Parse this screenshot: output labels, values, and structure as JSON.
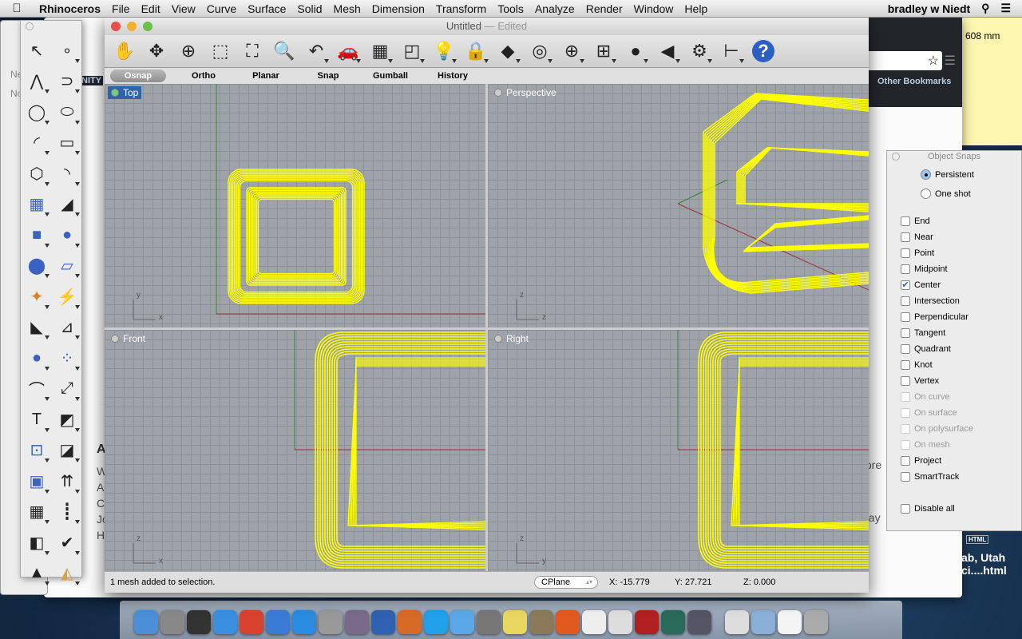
{
  "menubar": {
    "apple_icon": "apple-icon",
    "app": "Rhinoceros",
    "items": [
      "File",
      "Edit",
      "View",
      "Curve",
      "Surface",
      "Solid",
      "Mesh",
      "Dimension",
      "Transform",
      "Tools",
      "Analyze",
      "Render",
      "Window",
      "Help"
    ],
    "user": "bradley w Niedt"
  },
  "background": {
    "notes_text": "608 mm",
    "bookmarks": "Other Bookmarks",
    "nity": "NITY",
    "utah": "ab, Utah",
    "html": "ci....html",
    "html_badge": "HTML",
    "tore": "tore",
    "day": "day",
    "letters": [
      "A",
      "W",
      "A",
      "C",
      "Jo",
      "H"
    ],
    "no": "No",
    "ne": "Ne"
  },
  "window": {
    "title": "Untitled",
    "edited": "— Edited"
  },
  "toolbar": [
    {
      "icon": "hand-pan-icon",
      "g": "✋"
    },
    {
      "icon": "rotate-view-icon",
      "g": "✥"
    },
    {
      "icon": "zoom-in-out-icon",
      "g": "⊕"
    },
    {
      "icon": "zoom-window-icon",
      "g": "⬚"
    },
    {
      "icon": "zoom-extents-icon",
      "g": "⛶"
    },
    {
      "icon": "zoom-selected-icon",
      "g": "🔍"
    },
    {
      "icon": "undo-view-icon",
      "g": "↶"
    },
    {
      "icon": "car-view-icon",
      "g": "🚗"
    },
    {
      "icon": "cplane-icon",
      "g": "▦"
    },
    {
      "icon": "select-objects-icon",
      "g": "◰"
    },
    {
      "icon": "lightbulb-icon",
      "g": "💡"
    },
    {
      "icon": "lock-icon",
      "g": "🔒"
    },
    {
      "icon": "layers-icon",
      "g": "◆"
    },
    {
      "icon": "color-wheel-icon",
      "g": "◎"
    },
    {
      "icon": "wireframe-sphere-icon",
      "g": "⊕"
    },
    {
      "icon": "grid-sphere-icon",
      "g": "⊞"
    },
    {
      "icon": "render-sphere-icon",
      "g": "●"
    },
    {
      "icon": "render-cone-icon",
      "g": "◀"
    },
    {
      "icon": "options-gear-icon",
      "g": "⚙"
    },
    {
      "icon": "dimension-icon",
      "g": "⊢"
    },
    {
      "icon": "help-icon",
      "g": "?"
    }
  ],
  "tabs": [
    {
      "label": "Osnap",
      "active": true
    },
    {
      "label": "Ortho"
    },
    {
      "label": "Planar"
    },
    {
      "label": "Snap"
    },
    {
      "label": "Gumball"
    },
    {
      "label": "History"
    }
  ],
  "viewports": [
    {
      "label": "Top",
      "active": true
    },
    {
      "label": "Perspective"
    },
    {
      "label": "Front"
    },
    {
      "label": "Right"
    }
  ],
  "axes": {
    "x": "x",
    "y": "y",
    "z": "z"
  },
  "status": {
    "message": "1 mesh added to selection.",
    "cplane": "CPlane",
    "x": "X: -15.779",
    "y": "Y: 27.721",
    "z": "Z: 0.000"
  },
  "palette": [
    "select-arrow-icon",
    "point-icon",
    "polyline-icon",
    "curve-icon",
    "circle-icon",
    "ellipse-icon",
    "arc-icon",
    "rectangle-icon",
    "polygon-icon",
    "fillet-icon",
    "surface-icon",
    "loft-icon",
    "box-icon",
    "sphere-icon",
    "cylinder-icon",
    "plane-icon",
    "puzzle-join-icon",
    "explode-icon",
    "trim-icon",
    "split-icon",
    "boolean-icon",
    "group-icon",
    "offset-icon",
    "scale-icon",
    "text-icon",
    "transform-icon",
    "array-grid-icon",
    "bend-icon",
    "solid-edit-icon",
    "extrude-arrows-icon",
    "array-icon",
    "mirror-icon",
    "flow-icon",
    "check-icon",
    "shapes-icon",
    "render-material-icon"
  ],
  "palette_glyphs": [
    "↖",
    "∘",
    "⋀",
    "⊃",
    "◯",
    "⬭",
    "◜",
    "▭",
    "⬡",
    "◝",
    "▦",
    "◢",
    "■",
    "●",
    "⬤",
    "▱",
    "✦",
    "⚡",
    "◣",
    "⊿",
    "●",
    "⁘",
    "⌒",
    "⤢",
    "T",
    "◩",
    "⊡",
    "◪",
    "▣",
    "⇈",
    "▦",
    "┋",
    "◧",
    "✔",
    "▲",
    "◭"
  ],
  "snaps": {
    "title": "Object Snaps",
    "modes": [
      {
        "label": "Persistent",
        "on": true
      },
      {
        "label": "One shot",
        "on": false
      }
    ],
    "items": [
      {
        "label": "End"
      },
      {
        "label": "Near"
      },
      {
        "label": "Point"
      },
      {
        "label": "Midpoint"
      },
      {
        "label": "Center",
        "checked": true
      },
      {
        "label": "Intersection"
      },
      {
        "label": "Perpendicular"
      },
      {
        "label": "Tangent"
      },
      {
        "label": "Quadrant"
      },
      {
        "label": "Knot"
      },
      {
        "label": "Vertex"
      },
      {
        "label": "On curve",
        "disabled": true
      },
      {
        "label": "On surface",
        "disabled": true
      },
      {
        "label": "On polysurface",
        "disabled": true
      },
      {
        "label": "On mesh",
        "disabled": true
      },
      {
        "label": "Project"
      },
      {
        "label": "SmartTrack"
      }
    ],
    "disable_all": "Disable all"
  },
  "dock": [
    {
      "icon": "finder-icon",
      "c": "#4a8fd8"
    },
    {
      "icon": "launchpad-icon",
      "c": "#888"
    },
    {
      "icon": "dashboard-icon",
      "c": "#333"
    },
    {
      "icon": "itunes-icon",
      "c": "#3a8fe0"
    },
    {
      "icon": "chrome-icon",
      "c": "#d8422e"
    },
    {
      "icon": "safari-icon",
      "c": "#3a7bd5"
    },
    {
      "icon": "app-store-icon",
      "c": "#2a8be0"
    },
    {
      "icon": "xcode-icon",
      "c": "#999"
    },
    {
      "icon": "rhino-icon",
      "c": "#7a6a8a"
    },
    {
      "icon": "word-icon",
      "c": "#2f62b0"
    },
    {
      "icon": "powerpoint-icon",
      "c": "#d86a28"
    },
    {
      "icon": "skype-icon",
      "c": "#1fa0e8"
    },
    {
      "icon": "messages-icon",
      "c": "#5aa8e8"
    },
    {
      "icon": "system-preferences-icon",
      "c": "#777"
    },
    {
      "icon": "stickies-icon",
      "c": "#e8d860"
    },
    {
      "icon": "iphoto-icon",
      "c": "#8a7a5a"
    },
    {
      "icon": "audacity-icon",
      "c": "#e05a20"
    },
    {
      "icon": "calendar-icon",
      "c": "#eee"
    },
    {
      "icon": "textedit-icon",
      "c": "#ddd"
    },
    {
      "icon": "photo-booth-icon",
      "c": "#b02020"
    },
    {
      "icon": "time-machine-icon",
      "c": "#2a6a5a"
    },
    {
      "icon": "photo-app-icon",
      "c": "#556"
    },
    {
      "icon": "solitaire-icon",
      "c": "#ddd"
    },
    {
      "icon": "documents-folder-icon",
      "c": "#8ab0d8"
    },
    {
      "icon": "file-icon",
      "c": "#f4f4f4"
    },
    {
      "icon": "trash-icon",
      "c": "#aaa"
    }
  ],
  "colors": {
    "wire": "#ffff00",
    "viewport_bg": "#9ea2a9",
    "active_label": "#2f63a8",
    "x_axis": "#a03030",
    "y_axis": "#2f8a2f"
  }
}
